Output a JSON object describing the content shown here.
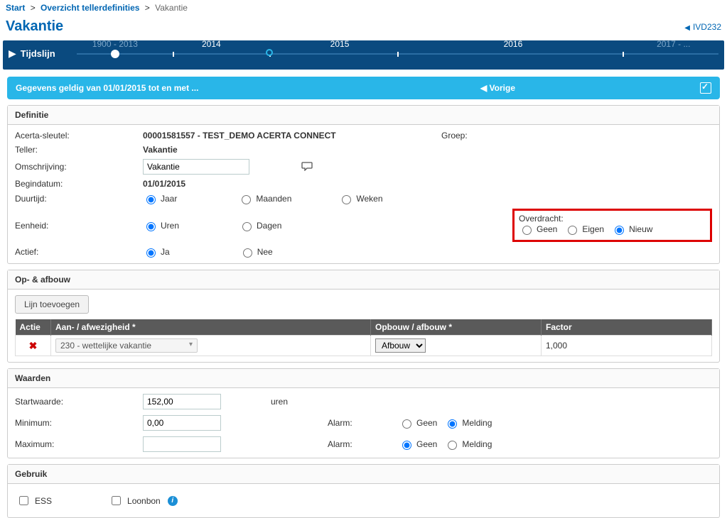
{
  "breadcrumb": {
    "start": "Start",
    "mid": "Overzicht tellerdefinities",
    "cur": "Vakantie"
  },
  "title": "Vakantie",
  "code": "IVD232",
  "timeline": {
    "label": "Tijdslijn",
    "y0": "1900 - 2013",
    "y1": "2014",
    "y2": "2015",
    "y3": "2016",
    "y4": "2017 - ..."
  },
  "validity": {
    "text": "Gegevens geldig van 01/01/2015 tot en met ...",
    "vorige": "◀ Vorige"
  },
  "definitie": {
    "header": "Definitie",
    "keyLbl": "Acerta-sleutel:",
    "keyVal": "00001581557 - TEST_DEMO ACERTA CONNECT",
    "tellerLbl": "Teller:",
    "tellerVal": "Vakantie",
    "omsLbl": "Omschrijving:",
    "omsVal": "Vakantie",
    "groepLbl": "Groep:",
    "beginLbl": "Begindatum:",
    "beginVal": "01/01/2015",
    "duurLbl": "Duurtijd:",
    "duur": {
      "jaar": "Jaar",
      "maanden": "Maanden",
      "weken": "Weken"
    },
    "eenLbl": "Eenheid:",
    "een": {
      "uren": "Uren",
      "dagen": "Dagen"
    },
    "actiefLbl": "Actief:",
    "actief": {
      "ja": "Ja",
      "nee": "Nee"
    },
    "overdrachtLbl": "Overdracht:",
    "overdracht": {
      "geen": "Geen",
      "eigen": "Eigen",
      "nieuw": "Nieuw"
    }
  },
  "opaf": {
    "header": "Op- & afbouw",
    "addBtn": "Lijn toevoegen",
    "cols": {
      "actie": "Actie",
      "aanaf": "Aan- / afwezigheid *",
      "opafb": "Opbouw / afbouw *",
      "factor": "Factor"
    },
    "row": {
      "aanaf": "230 - wettelijke vakantie",
      "opafb": "Afbouw",
      "factor": "1,000"
    }
  },
  "waarden": {
    "header": "Waarden",
    "startLbl": "Startwaarde:",
    "startVal": "152,00",
    "urenLbl": "uren",
    "minLbl": "Minimum:",
    "minVal": "0,00",
    "maxLbl": "Maximum:",
    "maxVal": "",
    "alarmLbl": "Alarm:",
    "alarm": {
      "geen": "Geen",
      "melding": "Melding"
    }
  },
  "gebruik": {
    "header": "Gebruik",
    "ess": "ESS",
    "loonbon": "Loonbon"
  }
}
